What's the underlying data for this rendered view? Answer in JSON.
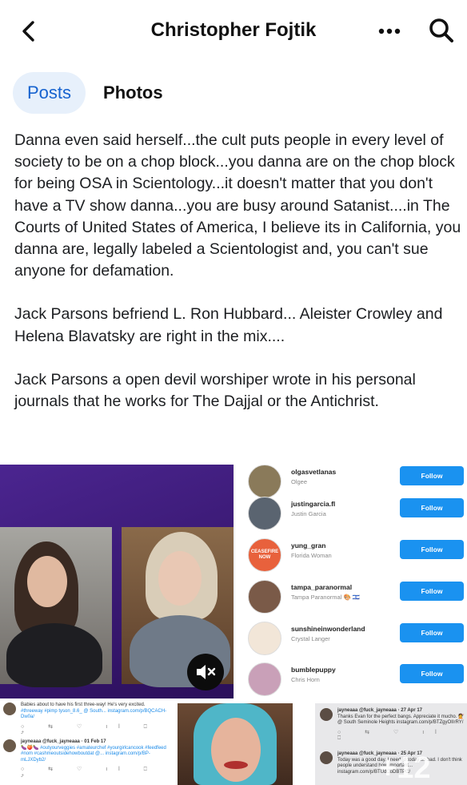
{
  "header": {
    "title": "Christopher Fojtik",
    "back_icon": "chevron-left-icon",
    "more_icon": "more-horizontal-icon",
    "search_icon": "search-icon"
  },
  "tabs": [
    {
      "label": "Posts",
      "active": true
    },
    {
      "label": "Photos",
      "active": false
    }
  ],
  "post": {
    "paragraphs": [
      "Danna even said herself...the cult puts people in every level of society to be on a chop block...you danna are on the chop block for being OSA in Scientology...it doesn't matter that you don't have a TV show danna...you are busy around Satanist....in The Courts of United States of America, I believe its in California, you danna are, legally labeled a Scientologist and, you can't sue anyone for defamation.",
      "Jack Parsons befriend L. Ron Hubbard... Aleister Crowley and Helena Blavatsky are right in the mix....",
      "Jack Parsons a open devil worshiper wrote in his personal journals that he works for The Dajjal or the Antichrist."
    ]
  },
  "collage": {
    "video": {
      "mute_icon": "volume-mute-icon"
    },
    "follow_list": [
      {
        "username": "olgasvetlanas",
        "name": "Olgee",
        "button": "Follow"
      },
      {
        "username": "justingarcia.fl",
        "name": "Justin Garcia",
        "button": "Follow"
      },
      {
        "username": "yung_gran",
        "name": "Florida Woman",
        "button": "Follow",
        "avatar_text": "CEASEFIRE NOW"
      },
      {
        "username": "tampa_paranormal",
        "name": "Tampa Paranormal 🎨 🇮🇱",
        "button": "Follow"
      },
      {
        "username": "sunshineinwonderland",
        "name": "Crystal Langer",
        "button": "Follow"
      },
      {
        "username": "bumblepuppy",
        "name": "Chris Horn",
        "button": "Follow"
      }
    ],
    "tweets_left": [
      {
        "text": "Babies about to have his first three-way! He's very excited.",
        "tags": "#threeway #pimp tyson_8.6_ @ South... instagram.com/p/BQCACH-Dw0a/"
      },
      {
        "handle": "jayneaaa @fuck_jayneaaa · 01 Feb 17",
        "text": "🍆🍑🍆 #outyourveggies #amateurchef #yourgirlcancook #feedfeed #nom #cashmeoutsidehowboutdat @... instagram.com/p/BP-mLJXDyb2/"
      }
    ],
    "tweets_right": [
      {
        "handle": "jayneaaa @fuck_jayneaaa · 27 Apr 17",
        "text": "Thanks Evan for the perfect bangs. Appreciate it mucho. 💇 @ South Seminole Heights instagram.com/p/BTZgyOIIrRY/"
      },
      {
        "handle": "jayneaaa @fuck_jayneaaa · 25 Apr 17",
        "text": "Today was a good day. I needed today so bad. I don't think people understand how important... instagram.com/p/BTUdCoDBTPC/"
      }
    ],
    "photo_overlay": "+12",
    "accent_color": "#1a92f0"
  }
}
